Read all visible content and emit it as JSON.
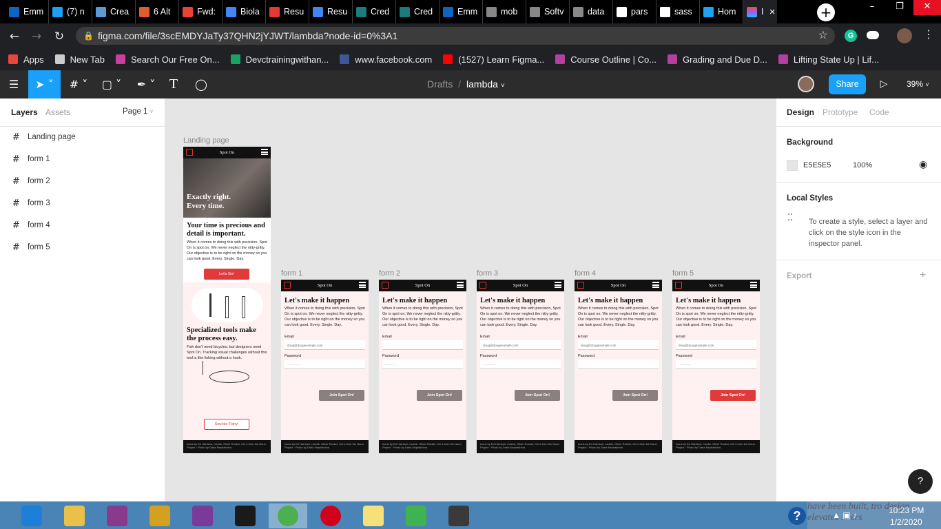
{
  "browser": {
    "tabs": [
      {
        "label": "Emm",
        "icon": "linkedin-icon",
        "color": "#0a66c2"
      },
      {
        "label": "(7) n",
        "icon": "twitter-icon",
        "color": "#1da1f2"
      },
      {
        "label": "Crea",
        "icon": "codepen-icon",
        "color": "#5a9bd5"
      },
      {
        "label": "6 Alt",
        "icon": "p-circle-icon",
        "color": "#e35d2a"
      },
      {
        "label": "Fwd:",
        "icon": "gmail-icon",
        "color": "#ea4335"
      },
      {
        "label": "Biola",
        "icon": "docs-icon",
        "color": "#4285f4"
      },
      {
        "label": "Resu",
        "icon": "pdf-icon",
        "color": "#e53935"
      },
      {
        "label": "Resu",
        "icon": "docs-icon",
        "color": "#4285f4"
      },
      {
        "label": "Cred",
        "icon": "c-icon",
        "color": "#1c7c7c"
      },
      {
        "label": "Cred",
        "icon": "c-icon",
        "color": "#1c7c7c"
      },
      {
        "label": "Emm",
        "icon": "linkedin-icon",
        "color": "#0a66c2"
      },
      {
        "label": "mob",
        "icon": "globe-icon",
        "color": "#888888"
      },
      {
        "label": "Softv",
        "icon": "globe-icon",
        "color": "#888888"
      },
      {
        "label": "data",
        "icon": "globe-icon",
        "color": "#888888"
      },
      {
        "label": "pars",
        "icon": "google-icon",
        "color": "#ffffff"
      },
      {
        "label": "sass",
        "icon": "google-icon",
        "color": "#ffffff"
      },
      {
        "label": "Hom",
        "icon": "twitter-icon",
        "color": "#1da1f2"
      }
    ],
    "active_tab": {
      "label": "I",
      "icon": "figma-icon"
    },
    "close_glyph": "✕",
    "new_tab_glyph": "+",
    "url": "figma.com/file/3scEMDYJaTy37QHN2jYJWT/lambda?node-id=0%3A1",
    "bookmarks": [
      {
        "label": "Apps",
        "color": "#e8453c"
      },
      {
        "label": "New Tab",
        "color": "#cccccc"
      },
      {
        "label": "Search Our Free On...",
        "color": "#c93fa0"
      },
      {
        "label": "Devctrainingwithan...",
        "color": "#1aa260"
      },
      {
        "label": "www.facebook.com",
        "color": "#3b5998"
      },
      {
        "label": "(1527) Learn Figma...",
        "color": "#ff0000"
      },
      {
        "label": "Course Outline | Co...",
        "color": "#b53f9e"
      },
      {
        "label": "Grading and Due D...",
        "color": "#b53f9e"
      },
      {
        "label": "Lifting State Up | Lif...",
        "color": "#b53f9e"
      }
    ]
  },
  "figma": {
    "breadcrumb_parent": "Drafts",
    "breadcrumb_sep": "/",
    "file_name": "lambda",
    "share_label": "Share",
    "zoom": "39%",
    "accent": "#18a0fb",
    "left_tabs": [
      "Layers",
      "Assets"
    ],
    "page_label": "Page 1",
    "layers": [
      "Landing page",
      "form 1",
      "form 2",
      "form 3",
      "form 4",
      "form 5"
    ],
    "right_tabs": [
      "Design",
      "Prototype",
      "Code"
    ],
    "background_title": "Background",
    "background_hex": "E5E5E5",
    "background_opacity": "100%",
    "local_styles_title": "Local Styles",
    "local_styles_hint": "To create a style, select a layer and click on the style icon in the inspector panel.",
    "export_title": "Export",
    "help_glyph": "?"
  },
  "canvas": {
    "landing": {
      "label": "Landing page",
      "brand": "Spot On",
      "hero": "Exactly right. Every time.",
      "heading1": "Your time is precious and detail is important.",
      "body1": "When it comes to doing this with precision, Spot On is spot on. We never neglect the nitty-gritty. Our objective is to be right on the money so you can look good. Every. Single. Day.",
      "cta1": "Let's Go!",
      "heading2": "Specialized tools make the process easy.",
      "body2": "Fish don't need bicycles, but designers need Spot On. Tracking visual challenges without this tool is like fishing without a hook.",
      "cta2": "Sounds Fishy!",
      "footer": "Icons by Ed Harrison, mcekk, Oliver Rocker, Ker's from the Noun Project · Photo by Daria Nepriakhina"
    },
    "forms": [
      {
        "label": "form 1",
        "email": "doug@dougexample.com",
        "password": "············",
        "active": false
      },
      {
        "label": "form 2",
        "email": "",
        "password": "············",
        "active": false
      },
      {
        "label": "form 3",
        "email": "doug@dougexample.com",
        "password": "············",
        "active": false
      },
      {
        "label": "form 4",
        "email": "doug@dougexample.com",
        "password": "",
        "active": false
      },
      {
        "label": "form 5",
        "email": "doug@dougexample.com",
        "password": "············",
        "active": true
      }
    ],
    "form_brand": "Spot On",
    "form_title": "Let's make it happen",
    "form_body": "When it comes to doing this with precision, Spot On is spot on. We never neglect the nitty-gritty. Our objective is to be right on the money so you can look good. Every. Single. Day.",
    "email_label": "Email",
    "password_label": "Password",
    "button_label": "Join Spot On!",
    "button_disabled_color": "#8c7f7f",
    "button_active_color": "#e03a3a",
    "footer": "Icons by Ed Harrison, mcekk, Oliver Rocker, Ker's from the Noun Project · Photo by Daria Nepriakhina"
  },
  "taskbar": {
    "time": "10:23 PM",
    "date": "1/2/2020",
    "wallpaper_text": "have been built, tro design elevates ... ers"
  }
}
